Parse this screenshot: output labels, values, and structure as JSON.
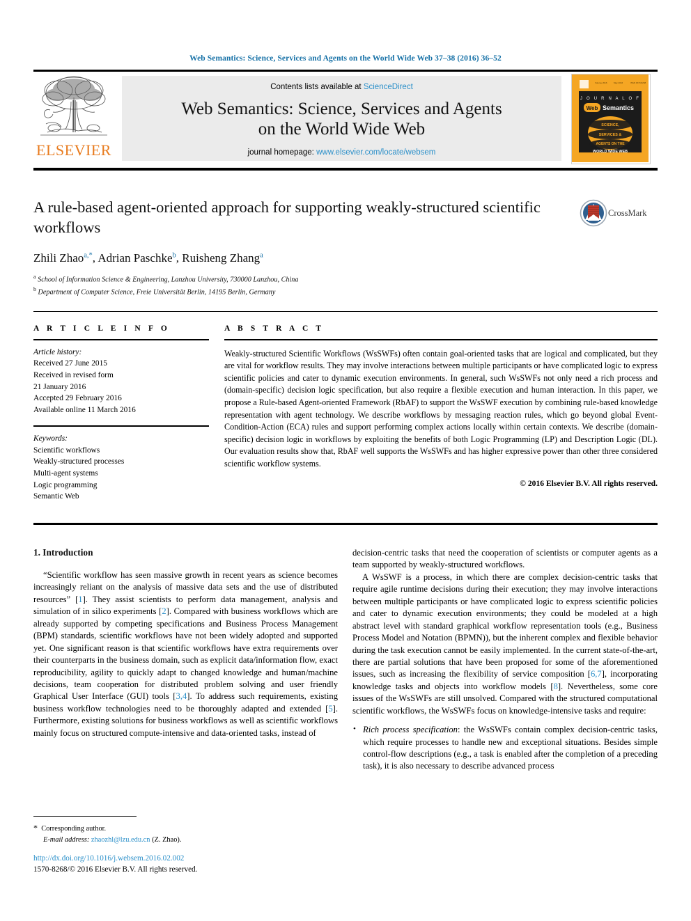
{
  "running_head": "Web Semantics: Science, Services and Agents on the World Wide Web 37–38 (2016) 36–52",
  "masthead": {
    "publisher": "ELSEVIER",
    "contents_prefix": "Contents lists available at ",
    "contents_link": "ScienceDirect",
    "journal_title_line1": "Web Semantics: Science, Services and Agents",
    "journal_title_line2": "on the World Wide Web",
    "homepage_prefix": "journal homepage: ",
    "homepage_url": "www.elsevier.com/locate/websem",
    "cover": {
      "line_journal_of": "J O U R N A L    O F",
      "line_web": "Web",
      "line_semantics": "Semantics",
      "globe_line1": "SCIENCE,",
      "globe_line2": "SERVICES &",
      "globe_line3": "AGENTS ON THE",
      "globe_line4": "WORLD WIDE WEB",
      "bg_color": "#f5a623"
    }
  },
  "article": {
    "title": "A rule-based agent-oriented approach for supporting weakly-structured scientific workflows",
    "authors_html": "Zhili Zhao, Adrian Paschke, Ruisheng Zhang",
    "authors": [
      {
        "name": "Zhili Zhao",
        "marks": "a,*"
      },
      {
        "name": "Adrian Paschke",
        "marks": "b"
      },
      {
        "name": "Ruisheng Zhang",
        "marks": "a"
      }
    ],
    "affiliations": [
      {
        "mark": "a",
        "text": "School of Information Science & Engineering, Lanzhou University, 730000 Lanzhou, China"
      },
      {
        "mark": "b",
        "text": "Department of Computer Science, Freie Universität Berlin, 14195 Berlin, Germany"
      }
    ],
    "crossmark_label": "CrossMark"
  },
  "info": {
    "heading": "A R T I C L E   I N F O",
    "history_label": "Article history:",
    "history": [
      "Received 27 June 2015",
      "Received in revised form",
      "21 January 2016",
      "Accepted 29 February 2016",
      "Available online 11 March 2016"
    ],
    "keywords_label": "Keywords:",
    "keywords": [
      "Scientific workflows",
      "Weakly-structured processes",
      "Multi-agent systems",
      "Logic programming",
      "Semantic Web"
    ]
  },
  "abstract": {
    "heading": "A B S T R A C T",
    "text": "Weakly-structured Scientific Workflows (WsSWFs) often contain goal-oriented tasks that are logical and complicated, but they are vital for workflow results. They may involve interactions between multiple participants or have complicated logic to express scientific policies and cater to dynamic execution environments. In general, such WsSWFs not only need a rich process and (domain-specific) decision logic specification, but also require a flexible execution and human interaction. In this paper, we propose a Rule-based Agent-oriented Framework (RbAF) to support the WsSWF execution by combining rule-based knowledge representation with agent technology. We describe workflows by messaging reaction rules, which go beyond global Event-Condition-Action (ECA) rules and support performing complex actions locally within certain contexts. We describe (domain-specific) decision logic in workflows by exploiting the benefits of both Logic Programming (LP) and Description Logic (DL). Our evaluation results show that, RbAF well supports the WsSWFs and has higher expressive power than other three considered scientific workflow systems.",
    "copyright": "© 2016 Elsevier B.V. All rights reserved."
  },
  "body": {
    "section_heading": "1. Introduction",
    "left_para_1_pre": "“Scientific workflow has seen massive growth in recent years as science becomes increasingly reliant on the analysis of massive data sets and the use of distributed resources” [",
    "left_para_1_ref1": "1",
    "left_para_1_mid1": "]. They assist scientists to perform data management, analysis and simulation of in silico experiments [",
    "left_para_1_ref2": "2",
    "left_para_1_mid2": "]. Compared with business workflows which are already supported by competing specifications and Business Process Management (BPM) standards, scientific workflows have not been widely adopted and supported yet. One significant reason is that scientific workflows have extra requirements over their counterparts in the business domain, such as explicit data/information flow, exact reproducibility, agility to quickly adapt to changed knowledge and human/machine decisions, team cooperation for distributed problem solving and user friendly Graphical User Interface (GUI) tools [",
    "left_para_1_ref3": "3,4",
    "left_para_1_mid3": "]. To address such requirements, existing business workflow technologies need to be thoroughly adapted and extended [",
    "left_para_1_ref4": "5",
    "left_para_1_end": "]. Furthermore, existing solutions for business workflows as well as scientific workflows mainly focus on structured compute-intensive and data-oriented tasks, instead of",
    "right_para_1": "decision-centric tasks that need the cooperation of scientists or computer agents as a team supported by weakly-structured workflows.",
    "right_para_2_pre": "A WsSWF is a process, in which there are complex decision-centric tasks that require agile runtime decisions during their execution; they may involve interactions between multiple participants or have complicated logic to express scientific policies and cater to dynamic execution environments; they could be modeled at a high abstract level with standard graphical workflow representation tools (e.g., Business Process Model and Notation (BPMN)), but the inherent complex and flexible behavior during the task execution cannot be easily implemented. In the current state-of-the-art, there are partial solutions that have been proposed for some of the aforementioned issues, such as increasing the flexibility of service composition [",
    "right_para_2_ref1": "6,7",
    "right_para_2_mid1": "], incorporating knowledge tasks and objects into workflow models [",
    "right_para_2_ref2": "8",
    "right_para_2_end": "]. Nevertheless, some core issues of the WsSWFs are still unsolved. Compared with the structured computational scientific workflows, the WsSWFs focus on knowledge-intensive tasks and require:",
    "bullet_1_label": "Rich process specification",
    "bullet_1_text": ": the WsSWFs contain complex decision-centric tasks, which require processes to handle new and exceptional situations. Besides simple control-flow descriptions (e.g., a task is enabled after the completion of a preceding task), it is also necessary to describe advanced process"
  },
  "footer": {
    "corresponding_star": "*",
    "corresponding_label": "Corresponding author.",
    "email_label": "E-mail address:",
    "email": "zhaozhl@lzu.edu.cn",
    "email_suffix": "(Z. Zhao).",
    "doi_url": "http://dx.doi.org/10.1016/j.websem.2016.02.002",
    "issn_line": "1570-8268/© 2016 Elsevier B.V. All rights reserved."
  },
  "colors": {
    "link": "#2a8fc9",
    "runhead": "#1570a6",
    "elsevier_orange": "#e87b1e",
    "band_gray": "#ebebeb"
  }
}
